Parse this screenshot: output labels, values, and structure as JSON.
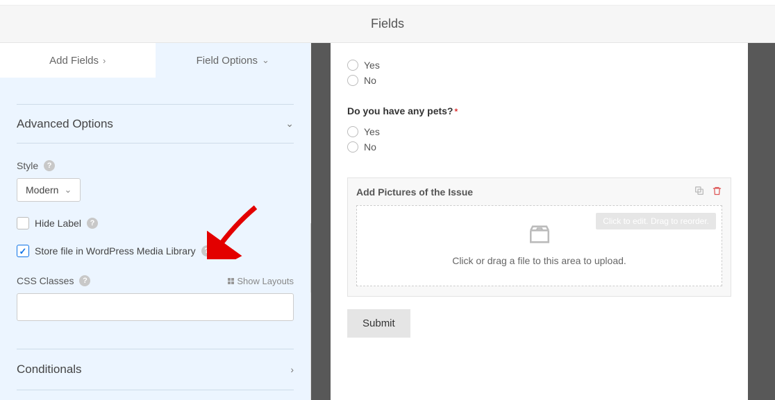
{
  "titlebar": {
    "title": "Fields"
  },
  "tabs": {
    "add": "Add Fields",
    "options": "Field Options"
  },
  "advanced": {
    "heading": "Advanced Options",
    "style_label": "Style",
    "style_value": "Modern",
    "hide_label": "Hide Label",
    "store_media": "Store file in WordPress Media Library",
    "css_label": "CSS Classes",
    "show_layouts": "Show Layouts",
    "css_value": ""
  },
  "conditionals": {
    "heading": "Conditionals"
  },
  "preview": {
    "radios1": {
      "yes": "Yes",
      "no": "No"
    },
    "question2": "Do you have any pets?",
    "radios2": {
      "yes": "Yes",
      "no": "No"
    },
    "upload": {
      "title": "Add Pictures of the Issue",
      "tooltip": "Click to edit. Drag to reorder.",
      "drop_text": "Click or drag a file to this area to upload."
    },
    "submit": "Submit"
  }
}
